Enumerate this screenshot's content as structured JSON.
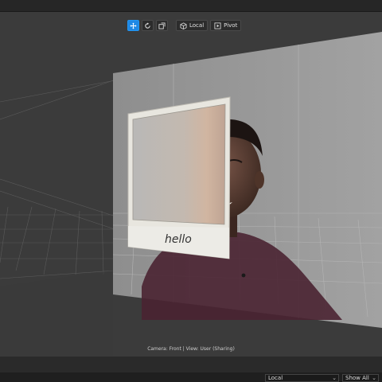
{
  "toolbar": {
    "move_icon": "move-icon",
    "rotate_icon": "rotate-icon",
    "scale_icon": "scale-icon",
    "local_label": "Local",
    "pivot_label": "Pivot",
    "active_color": "#1e88e5"
  },
  "scene": {
    "polaroid_caption": "hello"
  },
  "status": {
    "text": "Camera: Front | View: User (Sharing)"
  },
  "bottom_bar": {
    "space_select": "Local",
    "visibility_select": "Show All"
  }
}
